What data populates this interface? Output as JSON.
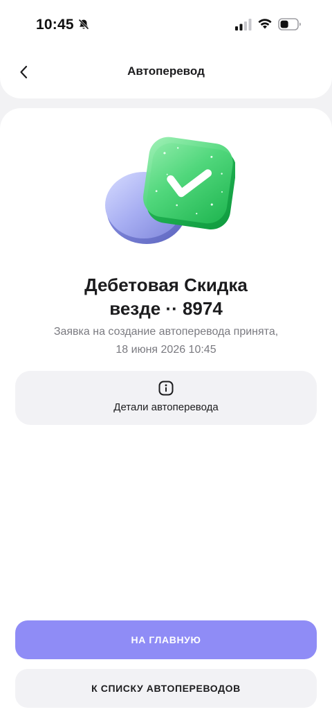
{
  "status_bar": {
    "time": "10:45",
    "icons": [
      "bell-slash-icon",
      "signal-icon",
      "wifi-icon",
      "battery-icon"
    ]
  },
  "header": {
    "title": "Автоперевод",
    "back_icon": "chevron-left-icon"
  },
  "result": {
    "illustration": "success-check-icon",
    "account_line1": "Дебетовая Скидка",
    "account_line2": "везде ·· 8974",
    "message_line1": "Заявка на создание автоперевода принята,",
    "message_line2": "18 июня 2026 10:45"
  },
  "details": {
    "icon": "info-icon",
    "label": "Детали автоперевода"
  },
  "actions": {
    "primary_label": "НА ГЛАВНУЮ",
    "secondary_label": "К СПИСКУ АВТОПЕРЕВОДОВ"
  },
  "colors": {
    "accent": "#8f8cf6",
    "success": "#3fd071",
    "background": "#f2f2f4"
  }
}
